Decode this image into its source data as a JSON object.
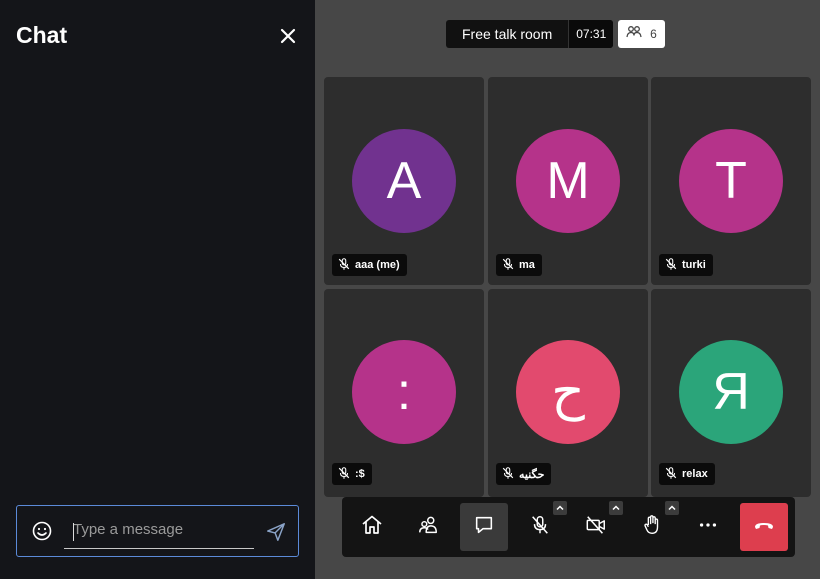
{
  "chat": {
    "title": "Chat",
    "input_placeholder": "Type a message",
    "input_value": ""
  },
  "room": {
    "name": "Free talk room",
    "timer": "07:31",
    "participant_count": "6"
  },
  "participants": [
    {
      "initial": "A",
      "name": "aaa (me)",
      "color": "#71328f",
      "muted": true
    },
    {
      "initial": "M",
      "name": "ma",
      "color": "#b5338a",
      "muted": true
    },
    {
      "initial": "T",
      "name": "turki",
      "color": "#b5338a",
      "muted": true
    },
    {
      "initial": ":",
      "name": ":$",
      "color": "#b5338a",
      "muted": true
    },
    {
      "initial": "ح",
      "name": "حگنيه",
      "color": "#e24a6e",
      "muted": true
    },
    {
      "initial": "Я",
      "name": "relax",
      "color": "#2ba57a",
      "muted": true
    }
  ],
  "toolbar": {
    "buttons": [
      "home-icon",
      "participants-icon",
      "chat-icon",
      "microphone-muted-icon",
      "camera-off-icon",
      "raise-hand-icon",
      "more-icon",
      "hangup-icon"
    ]
  },
  "colors": {
    "panel_bg": "#141519",
    "stage_bg": "#474747",
    "tile_bg": "#2d2d2d",
    "input_border": "#5b8ad8",
    "hangup": "#dd3e4e"
  }
}
